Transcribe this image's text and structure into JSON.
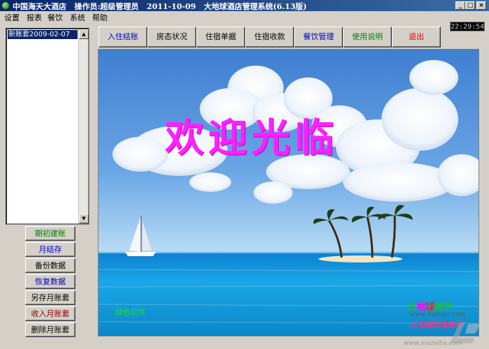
{
  "window": {
    "title": "中国海天大酒店   操作员:超级管理员   2011-10-09   大地球酒店管理系统(6.13版)",
    "icon": "globe-icon",
    "controls": [
      "minimize-icon",
      "maximize-icon",
      "close-icon"
    ]
  },
  "menu": {
    "items": [
      "设置",
      "报表",
      "餐饮",
      "系统",
      "帮助"
    ]
  },
  "clock": "22:29:54",
  "toolbar": {
    "buttons": [
      {
        "label": "入住结账",
        "color": "#0000c0"
      },
      {
        "label": "房态状况",
        "color": "#000000"
      },
      {
        "label": "住宿单据",
        "color": "#000000"
      },
      {
        "label": "住宿收款",
        "color": "#000000"
      },
      {
        "label": "餐饮管理",
        "color": "#0000c0"
      },
      {
        "label": "使用说明",
        "color": "#008000"
      },
      {
        "label": "退出",
        "color": "#e00000"
      }
    ]
  },
  "accounts": {
    "items": [
      "新账套2009-02-07"
    ]
  },
  "side_buttons": [
    {
      "label": "期初建账",
      "color": "#008000"
    },
    {
      "label": "月结存",
      "color": "#0000c0"
    },
    {
      "label": "备份数据",
      "color": "#000000"
    },
    {
      "label": "恢复数据",
      "color": "#0000c0"
    },
    {
      "label": "另存月账套",
      "color": "#000000"
    },
    {
      "label": "收入月账套",
      "color": "#800000"
    },
    {
      "label": "删除月账套",
      "color": "#000000"
    }
  ],
  "scene": {
    "welcome": "欢迎光临",
    "green_label": "绿色软件",
    "logo": {
      "brand_parts": [
        {
          "text": "大",
          "color": "#20c020"
        },
        {
          "text": "地",
          "color": "#ff00ff"
        },
        {
          "text": "球",
          "color": "#ff2020"
        },
        {
          "text": "软",
          "color": "#20c020"
        },
        {
          "text": "件",
          "color": "#20c020"
        }
      ],
      "url": "www.dadiqiu.com",
      "slogan": "大地球饮食软件"
    },
    "watermark_url": "www.xiazaiba.com"
  }
}
